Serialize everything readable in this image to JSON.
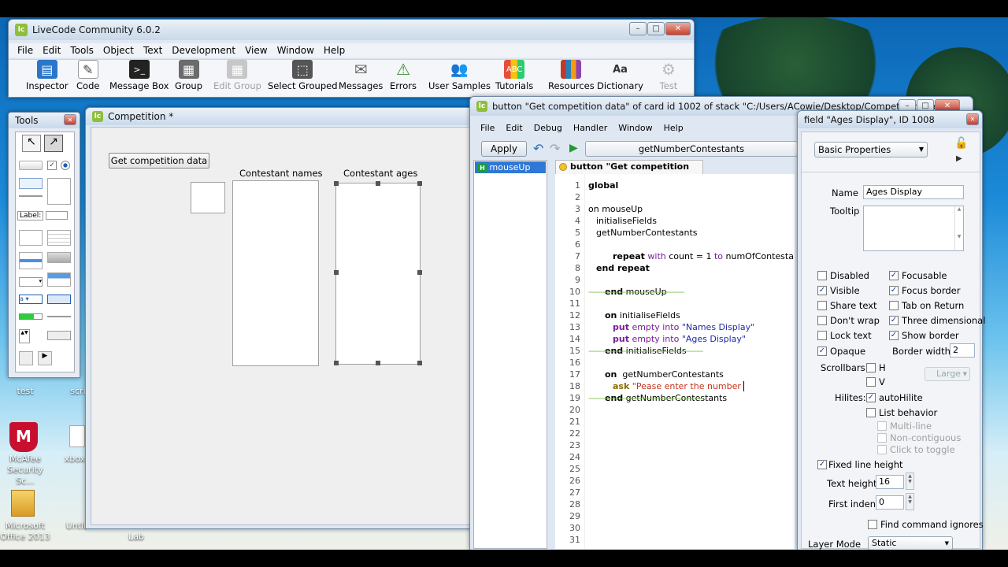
{
  "main_window": {
    "title": "LiveCode Community 6.0.2",
    "menu": [
      "File",
      "Edit",
      "Tools",
      "Object",
      "Text",
      "Development",
      "View",
      "Window",
      "Help"
    ],
    "toolbar": [
      {
        "label": "Inspector",
        "icon": "inspector-icon",
        "enabled": true
      },
      {
        "label": "Code",
        "icon": "code-icon",
        "enabled": true
      },
      {
        "label": "Message Box",
        "icon": "message-box-icon",
        "enabled": true
      },
      {
        "label": "Group",
        "icon": "group-icon",
        "enabled": true
      },
      {
        "label": "Edit Group",
        "icon": "edit-group-icon",
        "enabled": false
      },
      {
        "label": "Select Grouped",
        "icon": "select-grouped-icon",
        "enabled": true
      },
      {
        "label": "Messages",
        "icon": "messages-icon",
        "enabled": true
      },
      {
        "label": "Errors",
        "icon": "errors-icon",
        "enabled": true
      },
      {
        "label": "User Samples",
        "icon": "user-samples-icon",
        "enabled": true
      },
      {
        "label": "Tutorials",
        "icon": "tutorials-icon",
        "enabled": true
      },
      {
        "label": "Resources",
        "icon": "resources-icon",
        "enabled": true
      },
      {
        "label": "Dictionary",
        "icon": "dictionary-icon",
        "enabled": true
      },
      {
        "label": "Test",
        "icon": "test-icon",
        "enabled": false
      }
    ]
  },
  "tools_palette": {
    "title": "Tools",
    "label_field_text": "Label:"
  },
  "stack_window": {
    "title": "Competition *",
    "button_label": "Get competition data",
    "names_label": "Contestant names",
    "ages_label": "Contestant ages"
  },
  "script_editor": {
    "title": "button \"Get competition data\" of card id 1002 of stack \"C:/Users/ACowie/Desktop/Competition.livec",
    "menu": [
      "File",
      "Edit",
      "Debug",
      "Handler",
      "Window",
      "Help"
    ],
    "apply_label": "Apply",
    "handler_dropdown": "getNumberContestants",
    "handler_list": [
      "mouseUp"
    ],
    "object_tab": "button \"Get competition data\"",
    "line_numbers": [
      "1",
      "2",
      "3",
      "4",
      "5",
      "6",
      "7",
      "8",
      "9",
      "10",
      "11",
      "12",
      "13",
      "14",
      "15",
      "16",
      "17",
      "18",
      "19",
      "20",
      "21",
      "22",
      "23",
      "24",
      "25",
      "26",
      "27",
      "28",
      "29",
      "30",
      "31"
    ],
    "code": {
      "l1": "global",
      "l3": "on mouseUp",
      "l4": "initialiseFields",
      "l5": "getNumberContestants",
      "l6_kw": "repeat",
      "l6_with": " with ",
      "l6_count": "count = 1 ",
      "l6_to": "to",
      "l6_rest": " numOfContestants",
      "l8": "end repeat",
      "l9_kw": "end",
      "l9_rest": " mouseUp",
      "l10": "-----------------------------------------",
      "l11_kw": "on",
      "l11_rest": " initialiseFields",
      "l12_put": "put",
      "l12_empty": " empty into ",
      "l12_str": "\"Names Display\"",
      "l13_put": "put",
      "l13_empty": " empty into ",
      "l13_str": "\"Ages Display\"",
      "l14_kw": "end",
      "l14_rest": " initialiseFields",
      "l15": "-------------------------------------------------",
      "l16_kw": "on",
      "l16_rest": "  getNumberContestants",
      "l17_ask": "ask",
      "l17_str": " \"Pease enter the number ",
      "l18_kw": "end",
      "l18_rest": " getNumberContestants",
      "l19": "-------------------------------------------------"
    }
  },
  "inspector": {
    "title": "field \"Ages Display\", ID 1008",
    "section": "Basic Properties",
    "name_label": "Name",
    "name_value": "Ages Display",
    "tooltip_label": "Tooltip",
    "checks": [
      {
        "label": "Disabled",
        "checked": false
      },
      {
        "label": "Focusable",
        "checked": true
      },
      {
        "label": "Visible",
        "checked": true
      },
      {
        "label": "Focus border",
        "checked": true
      },
      {
        "label": "Share text",
        "checked": false
      },
      {
        "label": "Tab on Return",
        "checked": false
      },
      {
        "label": "Don't wrap",
        "checked": false
      },
      {
        "label": "Three dimensional",
        "checked": true
      },
      {
        "label": "Lock text",
        "checked": false
      },
      {
        "label": "Show border",
        "checked": true
      },
      {
        "label": "Opaque",
        "checked": true
      }
    ],
    "border_width_label": "Border width",
    "border_width_value": "2",
    "scrollbars_label": "Scrollbars:",
    "h_label": "H",
    "v_label": "V",
    "scrollbar_size": "Large",
    "hilites_label": "Hilites:",
    "autohilite_label": "autoHilite",
    "list_behavior_label": "List behavior",
    "multiline_label": "Multi-line",
    "noncontiguous_label": "Non-contiguous",
    "click_toggle_label": "Click to toggle",
    "fixed_line_height_label": "Fixed line height",
    "text_height_label": "Text height",
    "text_height_value": "16",
    "first_indent_label": "First indent",
    "first_indent_value": "0",
    "find_command_label": "Find command ignores",
    "layer_mode_label": "Layer Mode",
    "layer_mode_value": "Static"
  },
  "desktop_icons": [
    {
      "label": "test"
    },
    {
      "label": "scri"
    },
    {
      "label": "McAfee Security Sc..."
    },
    {
      "label": "xbox"
    },
    {
      "label": "Microsoft Office 2013"
    },
    {
      "label": "Untit"
    },
    {
      "label": "Lab"
    }
  ]
}
